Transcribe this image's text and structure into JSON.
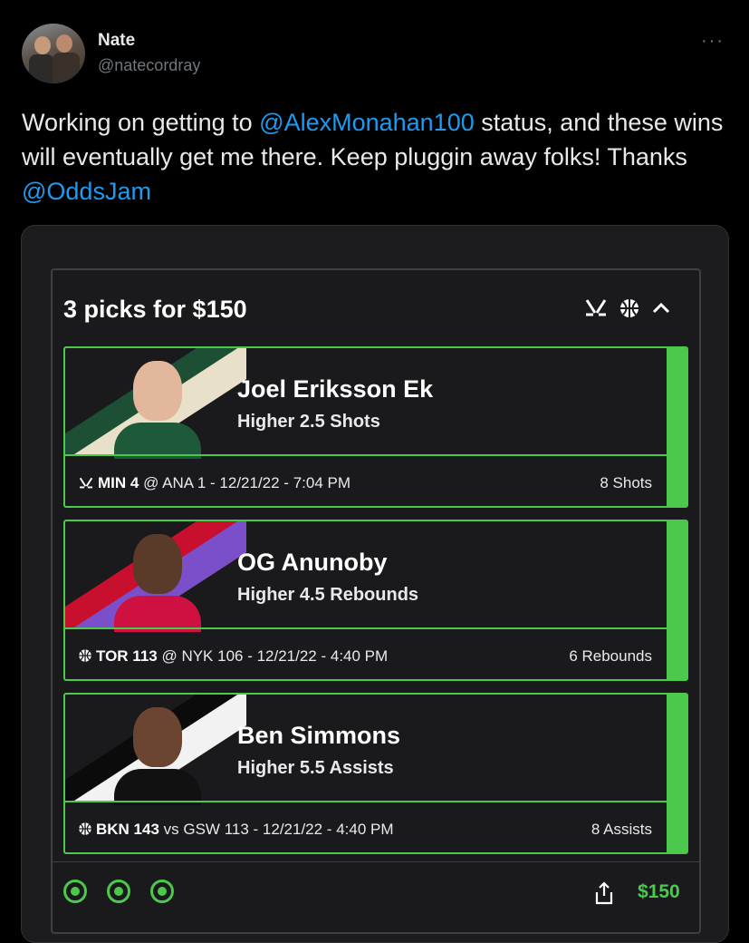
{
  "author": {
    "name": "Nate",
    "handle": "@natecordray"
  },
  "more_label": "···",
  "tweet": {
    "text_1": "Working on getting to ",
    "mention_1": "@AlexMonahan100",
    "text_2": " status, and these wins will eventually get me there. Keep pluggin away folks! Thanks ",
    "mention_2": "@OddsJam"
  },
  "card": {
    "title": "3 picks for $150",
    "total": "$150",
    "picks": [
      {
        "player": "Joel Eriksson Ek",
        "line": "Higher 2.5 Shots",
        "sport_icon": "hockey-icon",
        "team": "MIN 4",
        "matchup": " @ ANA 1 - 12/21/22 - 7:04 PM",
        "result": "8 Shots",
        "stripe_colors": [
          "#1c4f33",
          "#e8e0c8"
        ],
        "shirt_color": "#1d5a3a",
        "skin_color": "#e2b79b"
      },
      {
        "player": "OG Anunoby",
        "line": "Higher 4.5 Rebounds",
        "sport_icon": "basketball-icon",
        "team": "TOR 113",
        "matchup": " @ NYK 106 - 12/21/22 - 4:40 PM",
        "result": "6 Rebounds",
        "stripe_colors": [
          "#c8102e",
          "#7b4fc9"
        ],
        "shirt_color": "#ce1141",
        "skin_color": "#5a3b2a"
      },
      {
        "player": "Ben Simmons",
        "line": "Higher 5.5 Assists",
        "sport_icon": "basketball-icon",
        "team": "BKN 143",
        "matchup": " vs GSW 113 - 12/21/22 - 4:40 PM",
        "result": "8 Assists",
        "stripe_colors": [
          "#0b0b0b",
          "#f2f2f2"
        ],
        "shirt_color": "#111111",
        "skin_color": "#6b4532"
      }
    ]
  },
  "colors": {
    "accent_green": "#4cc94c",
    "link_blue": "#1d9bf0"
  }
}
